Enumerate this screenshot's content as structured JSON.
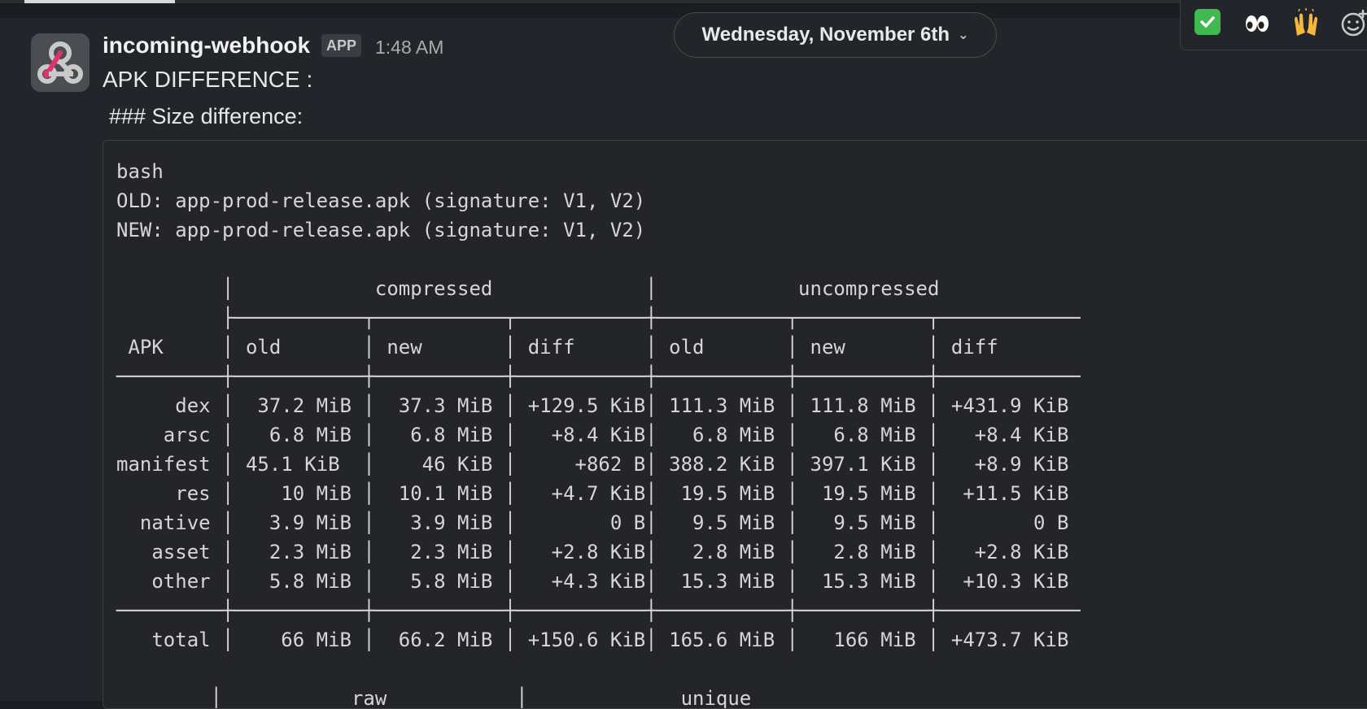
{
  "message": {
    "sender": "incoming-webhook",
    "badge": "APP",
    "time": "1:48 AM",
    "line1": "APK DIFFERENCE :",
    "line2": "### Size difference:"
  },
  "date_divider": {
    "label": "Wednesday, November 6th"
  },
  "reactions": [
    {
      "icon": "white-check-mark-icon"
    },
    {
      "icon": "eyes-icon"
    },
    {
      "icon": "raised-hands-icon"
    },
    {
      "icon": "add-reaction-icon"
    }
  ],
  "code_block": {
    "text": "bash\nOLD: app-prod-release.apk (signature: V1, V2)\nNEW: app-prod-release.apk (signature: V1, V2)\n\n         │            compressed             │            uncompressed\n         ├───────────┬───────────┬───────────┼───────────┬───────────┬────────────\n APK     │ old       │ new       │ diff      │ old       │ new       │ diff\n─────────┼───────────┼───────────┼───────────┼───────────┼───────────┼────────────\n     dex │  37.2 MiB │  37.3 MiB │ +129.5 KiB│ 111.3 MiB │ 111.8 MiB │ +431.9 KiB\n    arsc │   6.8 MiB │   6.8 MiB │   +8.4 KiB│   6.8 MiB │   6.8 MiB │   +8.4 KiB\nmanifest │ 45.1 KiB  │    46 KiB │     +862 B│ 388.2 KiB │ 397.1 KiB │   +8.9 KiB\n     res │    10 MiB │  10.1 MiB │   +4.7 KiB│  19.5 MiB │  19.5 MiB │  +11.5 KiB\n  native │   3.9 MiB │   3.9 MiB │        0 B│   9.5 MiB │   9.5 MiB │        0 B\n   asset │   2.3 MiB │   2.3 MiB │   +2.8 KiB│   2.8 MiB │   2.8 MiB │   +2.8 KiB\n   other │   5.8 MiB │   5.8 MiB │   +4.3 KiB│  15.3 MiB │  15.3 MiB │  +10.3 KiB\n─────────┼───────────┼───────────┼───────────┼───────────┼───────────┼────────────\n   total │    66 MiB │  66.2 MiB │ +150.6 KiB│ 165.6 MiB │   166 MiB │ +473.7 KiB\n\n        │           raw           │             unique"
  }
}
